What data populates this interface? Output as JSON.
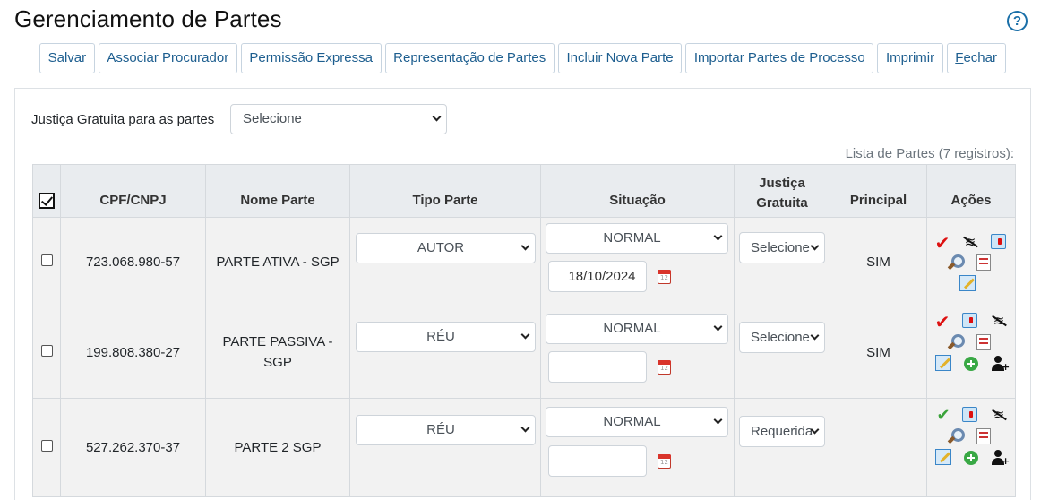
{
  "header": {
    "title": "Gerenciamento de Partes",
    "help_icon": "help-icon"
  },
  "toolbar": {
    "buttons": [
      "Salvar",
      "Associar Procurador",
      "Permissão Expressa",
      "Representação de Partes",
      "Incluir Nova Parte",
      "Importar Partes de Processo",
      "Imprimir",
      "Fechar"
    ]
  },
  "filter": {
    "label": "Justiça Gratuita para as partes",
    "selected": "Selecione"
  },
  "list_count": "Lista de Partes (7 registros):",
  "table": {
    "header_checked": true,
    "columns": [
      "CPF/CNPJ",
      "Nome Parte",
      "Tipo Parte",
      "Situação",
      "Justiça Gratuita",
      "Principal",
      "Ações"
    ],
    "rows": [
      {
        "checked": false,
        "cpf": "723.068.980-57",
        "nome": "PARTE ATIVA - SGP",
        "tipo": "AUTOR",
        "situacao": "NORMAL",
        "data": "18/10/2024",
        "justica": "Selecione",
        "principal": "SIM",
        "actions": [
          "check-red-icon",
          "wifi-off-icon",
          "trash-icon",
          "search-icon",
          "list-icon",
          "edit-icon"
        ]
      },
      {
        "checked": false,
        "cpf": "199.808.380-27",
        "nome": "PARTE PASSIVA - SGP",
        "tipo": "RÉU",
        "situacao": "NORMAL",
        "data": "",
        "justica": "Selecione",
        "principal": "SIM",
        "actions": [
          "check-red-icon",
          "trash-icon",
          "wifi-off-icon",
          "search-icon",
          "list-icon",
          "edit-icon",
          "add-icon",
          "add-user-icon"
        ]
      },
      {
        "checked": false,
        "cpf": "527.262.370-37",
        "nome": "PARTE 2 SGP",
        "tipo": "RÉU",
        "situacao": "NORMAL",
        "data": "",
        "justica": "Requerida",
        "principal": "",
        "actions": [
          "check-green-icon",
          "trash-icon",
          "wifi-off-icon",
          "search-icon",
          "list-icon",
          "edit-icon",
          "add-icon",
          "add-user-icon"
        ]
      }
    ]
  },
  "colors": {
    "button_text": "#1d5e8f",
    "header_bg": "#e9ecef",
    "row_bg": "#f2f2f2"
  }
}
